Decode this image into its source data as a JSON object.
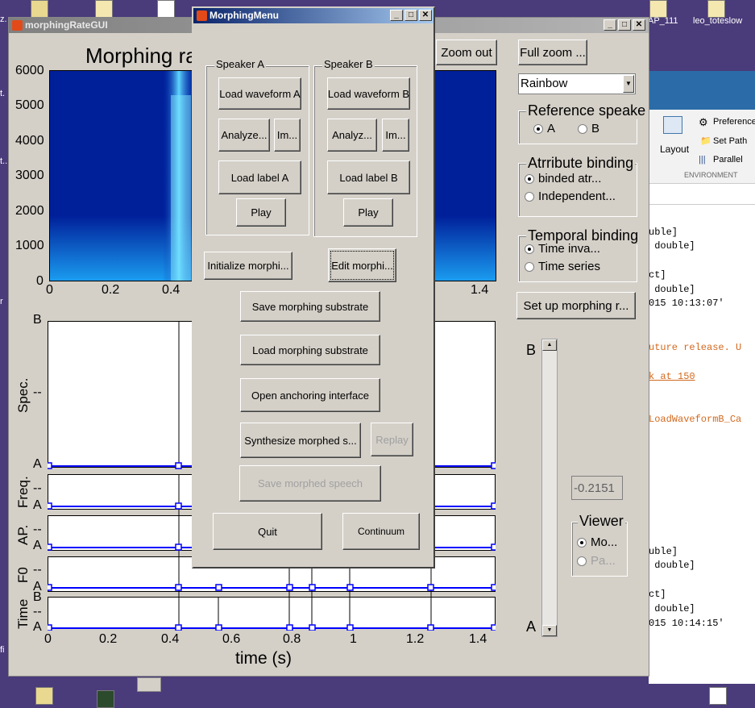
{
  "desktop": {
    "icon_labels": [
      "AP_111",
      "leo_toteslow"
    ],
    "left_edge_texts": [
      "z.",
      "t.",
      "t..",
      "r",
      "fi"
    ]
  },
  "matlab": {
    "toolbar": {
      "layout_label": "Layout",
      "preferences_label": "Preferences",
      "set_path_label": "Set Path",
      "parallel_label": "Parallel",
      "section_label": "ENVIRONMENT"
    },
    "code_lines": [
      "uble]",
      " double]",
      "ct]",
      " double]",
      "015 10:13:07'",
      "uture release. U",
      "k at 150",
      "LoadWaveformB_Ca",
      "uble]",
      " double]",
      "ct]",
      " double]",
      "015 10:14:15'"
    ]
  },
  "main_window": {
    "title": "morphingRateGUI",
    "plot_title": "Morphing ra",
    "zoom_out_label": "Zoom out",
    "full_zoom_label": "Full zoom ...",
    "colormap_select": "Rainbow",
    "reference_speaker": {
      "label": "Reference speake",
      "options": [
        "A",
        "B"
      ],
      "selected": "A"
    },
    "attribute_binding": {
      "label": "Atrribute binding",
      "options": [
        "binded atr...",
        "Independent..."
      ],
      "selected": "binded atr..."
    },
    "temporal_binding": {
      "label": "Temporal binding",
      "options": [
        "Time inva...",
        "Time series"
      ],
      "selected": "Time inva..."
    },
    "setup_button": "Set up morphing r...",
    "slider_top_label": "B",
    "slider_bottom_label": "A",
    "slider_value": "-0.2151",
    "viewer": {
      "label": "Viewer",
      "options": [
        "Mo...",
        "Pa..."
      ],
      "selected": "Mo..."
    },
    "spectrogram": {
      "y_ticks": [
        "6000",
        "5000",
        "4000",
        "3000",
        "2000",
        "1000",
        "0"
      ],
      "x_ticks": [
        "0",
        "0.2",
        "0.4",
        "1.4"
      ]
    },
    "panels": [
      {
        "ylabel": "Spec.",
        "ticks": [
          "B",
          "--",
          "A"
        ]
      },
      {
        "ylabel": "Freq.",
        "ticks": [
          "--",
          "A"
        ]
      },
      {
        "ylabel": "AP.",
        "ticks": [
          "--",
          "A"
        ]
      },
      {
        "ylabel": "F0",
        "ticks": [
          "--",
          "A"
        ]
      },
      {
        "ylabel": "Time",
        "ticks": [
          "B",
          "--",
          "A"
        ]
      }
    ],
    "bottom_x_ticks": [
      "0",
      "0.2",
      "0.4",
      "0.6",
      "0.8",
      "1",
      "1.2",
      "1.4"
    ],
    "xlabel": "time (s)"
  },
  "menu_window": {
    "title": "MorphingMenu",
    "speaker_a": {
      "label": "Speaker A",
      "load_waveform": "Load waveform A",
      "analyze": "Analyze...",
      "im": "Im...",
      "load_label": "Load label A",
      "play": "Play"
    },
    "speaker_b": {
      "label": "Speaker B",
      "load_waveform": "Load waveform B",
      "analyze": "Analyz...",
      "im": "Im...",
      "load_label": "Load label B",
      "play": "Play"
    },
    "initialize": "Initialize morphi...",
    "edit": "Edit morphi...",
    "save_substrate": "Save morphing substrate",
    "load_substrate": "Load morphing substrate",
    "open_anchoring": "Open anchoring interface",
    "synthesize": "Synthesize morphed s...",
    "replay": "Replay",
    "save_speech": "Save morphed speech",
    "quit": "Quit",
    "continuum": "Continuum"
  }
}
